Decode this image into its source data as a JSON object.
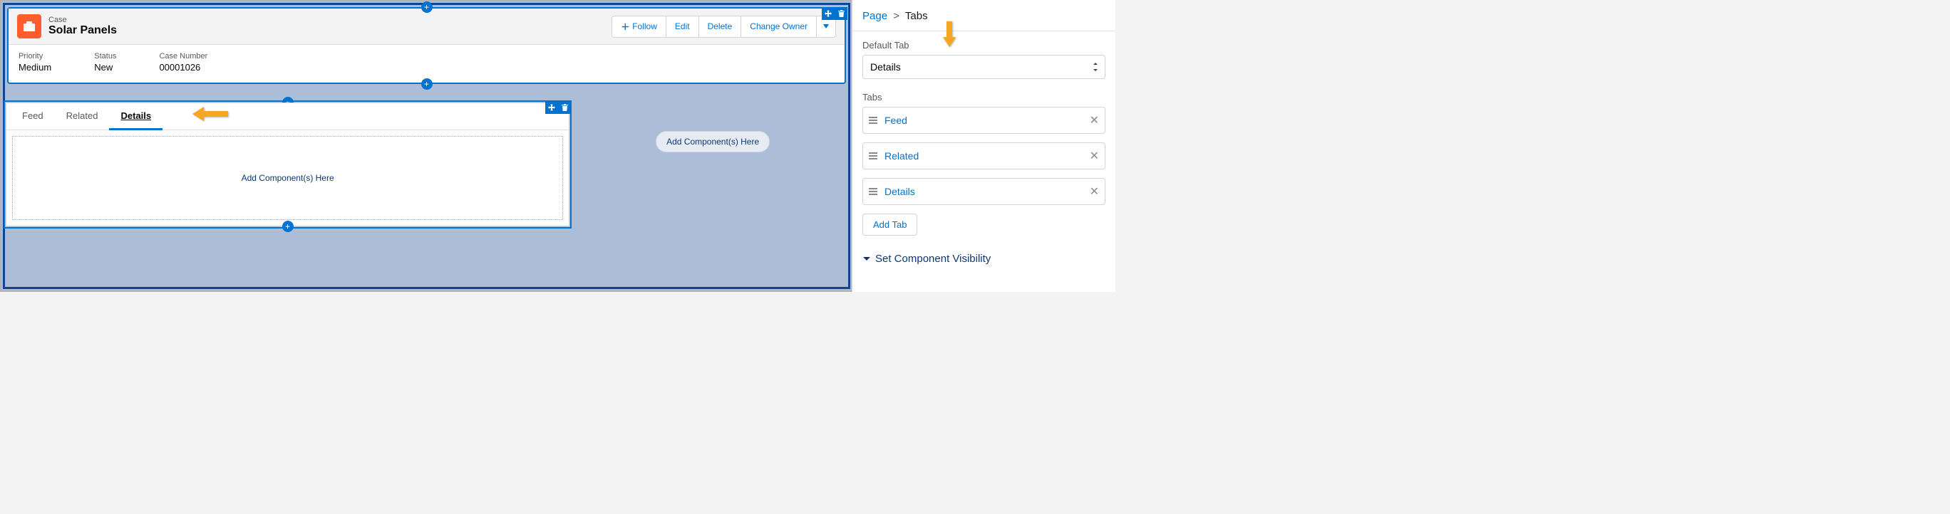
{
  "header": {
    "object_label": "Case",
    "title": "Solar Panels",
    "actions": {
      "follow": "Follow",
      "edit": "Edit",
      "delete": "Delete",
      "change_owner": "Change Owner"
    },
    "fields": [
      {
        "label": "Priority",
        "value": "Medium"
      },
      {
        "label": "Status",
        "value": "New"
      },
      {
        "label": "Case Number",
        "value": "00001026"
      }
    ]
  },
  "main_tabs": {
    "items": [
      {
        "label": "Feed",
        "active": false
      },
      {
        "label": "Related",
        "active": false
      },
      {
        "label": "Details",
        "active": true
      }
    ],
    "dropzone_text": "Add Component(s) Here"
  },
  "side_dropzone": {
    "text": "Add Component(s) Here"
  },
  "inspector": {
    "breadcrumb": {
      "root": "Page",
      "current": "Tabs"
    },
    "default_tab": {
      "label": "Default Tab",
      "value": "Details"
    },
    "tabs_section": {
      "label": "Tabs",
      "items": [
        {
          "name": "Feed"
        },
        {
          "name": "Related"
        },
        {
          "name": "Details"
        }
      ],
      "add_button": "Add Tab"
    },
    "visibility_label": "Set Component Visibility"
  }
}
